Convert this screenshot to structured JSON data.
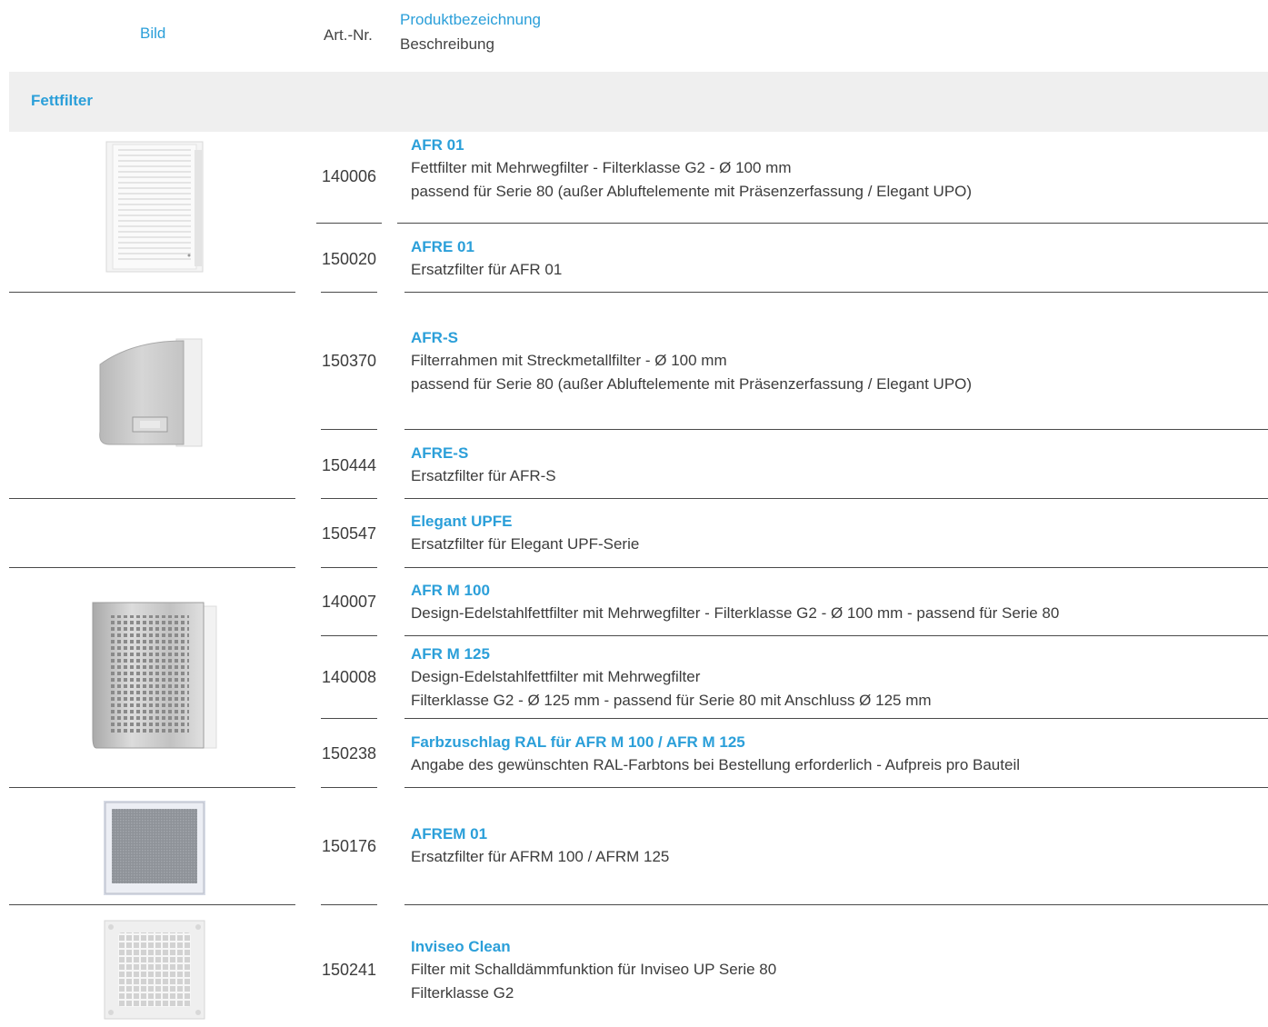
{
  "header": {
    "bild": "Bild",
    "art_nr": "Art.-Nr.",
    "produktbezeichnung": "Produktbezeichnung",
    "beschreibung": "Beschreibung"
  },
  "category": "Fettfilter",
  "products": [
    {
      "art_nr": "140006",
      "name": "AFR 01",
      "lines": [
        "Fettfilter mit Mehrwegfilter - Filterklasse G2 - Ø 100 mm",
        "passend für Serie 80 (außer Abluftelemente mit Präsenzerfassung / Elegant UPO)"
      ]
    },
    {
      "art_nr": "150020",
      "name": "AFRE 01",
      "lines": [
        "Ersatzfilter für AFR 01"
      ]
    },
    {
      "art_nr": "150370",
      "name": "AFR-S",
      "lines": [
        "Filterrahmen mit Streckmetallfilter - Ø 100 mm",
        "passend für Serie 80 (außer Abluftelemente mit Präsenzerfassung / Elegant UPO)"
      ]
    },
    {
      "art_nr": "150444",
      "name": "AFRE-S",
      "lines": [
        "Ersatzfilter für AFR-S"
      ]
    },
    {
      "art_nr": "150547",
      "name": "Elegant UPFE",
      "lines": [
        "Ersatzfilter für Elegant UPF-Serie"
      ]
    },
    {
      "art_nr": "140007",
      "name": "AFR M 100",
      "lines": [
        "Design-Edelstahlfettfilter mit Mehrwegfilter - Filterklasse G2 - Ø 100 mm - passend für Serie 80"
      ]
    },
    {
      "art_nr": "140008",
      "name": "AFR M 125",
      "lines": [
        "Design-Edelstahlfettfilter mit Mehrwegfilter",
        "Filterklasse G2 - Ø 125 mm -  passend für Serie 80 mit Anschluss Ø 125 mm"
      ]
    },
    {
      "art_nr": "150238",
      "name": "Farbzuschlag RAL für AFR M 100 / AFR M 125",
      "lines": [
        "Angabe des gewünschten RAL-Farbtons bei Bestellung erforderlich - Aufpreis pro Bauteil"
      ]
    },
    {
      "art_nr": "150176",
      "name": "AFREM 01",
      "lines": [
        "Ersatzfilter für AFRM 100 / AFRM 125"
      ]
    },
    {
      "art_nr": "150241",
      "name": "Inviseo Clean",
      "lines": [
        "Filter mit Schalldämmfunktion für Inviseo UP Serie 80",
        "Filterklasse G2"
      ]
    }
  ]
}
